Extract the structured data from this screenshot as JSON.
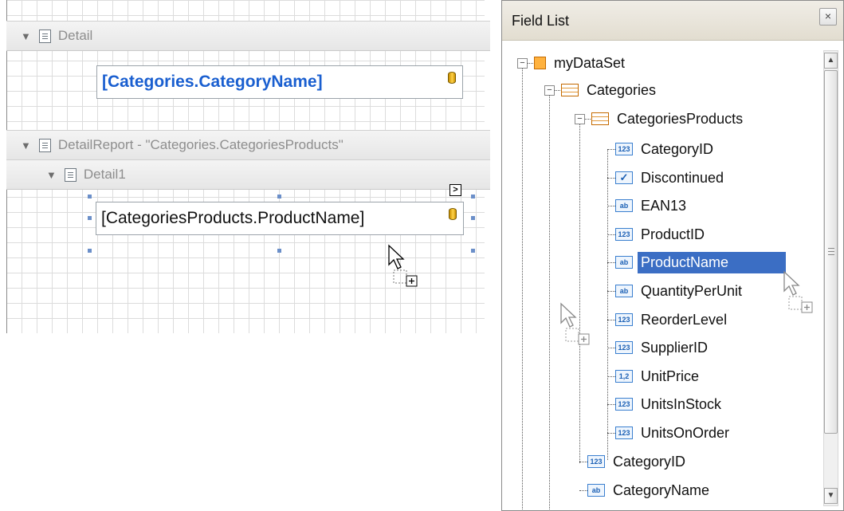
{
  "designer": {
    "bands": [
      {
        "label": "Detail"
      },
      {
        "label": "DetailReport - \"Categories.CategoriesProducts\""
      },
      {
        "label": "Detail1"
      }
    ],
    "fields": [
      {
        "text": "[Categories.CategoryName]",
        "color": "#1a5fd0",
        "bold": true
      },
      {
        "text": "[CategoriesProducts.ProductName]",
        "color": "#111111",
        "bold": false
      }
    ]
  },
  "field_list": {
    "title": "Field List",
    "close_glyph": "×",
    "tree": [
      {
        "label": "myDataSet",
        "icon": "dataset-icon"
      },
      {
        "label": "Categories",
        "icon": "table-icon"
      },
      {
        "label": "CategoriesProducts",
        "icon": "table-icon"
      },
      {
        "label": "CategoryID",
        "icon": "number-icon",
        "badge": "123"
      },
      {
        "label": "Discontinued",
        "icon": "boolean-icon",
        "badge": "✓"
      },
      {
        "label": "EAN13",
        "icon": "string-icon",
        "badge": "ab"
      },
      {
        "label": "ProductID",
        "icon": "number-icon",
        "badge": "123"
      },
      {
        "label": "ProductName",
        "icon": "string-icon",
        "badge": "ab",
        "selected": true
      },
      {
        "label": "QuantityPerUnit",
        "icon": "string-icon",
        "badge": "ab"
      },
      {
        "label": "ReorderLevel",
        "icon": "number-icon",
        "badge": "123"
      },
      {
        "label": "SupplierID",
        "icon": "number-icon",
        "badge": "123"
      },
      {
        "label": "UnitPrice",
        "icon": "decimal-icon",
        "badge": "1,2"
      },
      {
        "label": "UnitsInStock",
        "icon": "number-icon",
        "badge": "123"
      },
      {
        "label": "UnitsOnOrder",
        "icon": "number-icon",
        "badge": "123"
      },
      {
        "label": "CategoryID",
        "icon": "number-icon",
        "badge": "123"
      },
      {
        "label": "CategoryName",
        "icon": "string-icon",
        "badge": "ab"
      }
    ]
  },
  "colors": {
    "selection": "#3b6ec4",
    "band_text": "#8e8e8e",
    "handle": "#6b8fc9"
  }
}
